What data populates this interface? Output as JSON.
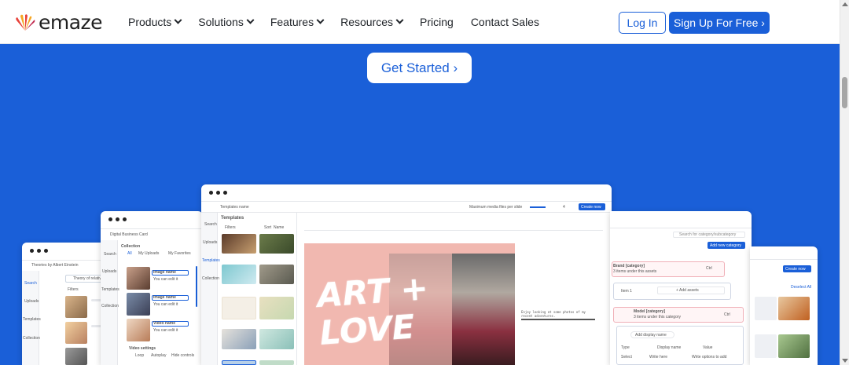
{
  "brand": {
    "name": "emaze"
  },
  "nav": {
    "items": [
      "Products",
      "Solutions",
      "Features",
      "Resources",
      "Pricing",
      "Contact Sales"
    ]
  },
  "auth": {
    "login": "Log In",
    "signup": "Sign Up For Free ›"
  },
  "hero": {
    "cta": "Get Started ›"
  },
  "colors": {
    "brand_blue": "#1a5fd8",
    "accent_red": "#e8423a",
    "accent_orange": "#f6a623"
  },
  "screens": {
    "left": {
      "title": "Theories by Albert Einstein",
      "search_value": "Theory of relativity",
      "filters": "Filters",
      "side": [
        "Search",
        "Uploads",
        "Templates",
        "Collection"
      ]
    },
    "mid_left": {
      "title": "Digital Business Card",
      "collection": "Collection",
      "tabs": [
        "All",
        "My Uploads",
        "My Favorites"
      ],
      "side": [
        "Search",
        "Uploads",
        "Templates",
        "Collection"
      ],
      "items": [
        {
          "label": "Image name",
          "sub": "You can edit it"
        },
        {
          "label": "Image name",
          "sub": "You can edit it"
        },
        {
          "label": "Video name",
          "sub": "You can edit it"
        }
      ],
      "video_settings": "Video settings",
      "video_opts": [
        "Loop",
        "Autoplay",
        "Hide controls"
      ]
    },
    "main": {
      "tab": "Templates name",
      "templates_label": "Templates",
      "filters": "Filters",
      "sort": "Sort",
      "sort_value": "Name",
      "max_media": "Maximum media files per slide",
      "max_value": "4",
      "create": "Create now",
      "side": [
        "Search",
        "Uploads",
        "Templates",
        "Collection"
      ],
      "art_line1": "ART +",
      "art_line2": "LOVE",
      "caption": "Enjoy looking at some photos of my recent adventures."
    },
    "right": {
      "search": "Search for category/subcategory",
      "add": "Add new category",
      "brand": "Brand [category]",
      "brand_sub": "3 items under this assets",
      "item1": "Item 1",
      "add_assets": "+ Add assets",
      "model": "Model [category]",
      "model_sub": "3 items under this category",
      "display_name": "Add display name",
      "cols": [
        "Type",
        "Display name",
        "Value"
      ],
      "row": [
        "Select",
        "Write here",
        "Write options to add"
      ],
      "dropdown": "Ctrl"
    },
    "far_right": {
      "create": "Create now",
      "deselect": "Deselect All"
    }
  }
}
